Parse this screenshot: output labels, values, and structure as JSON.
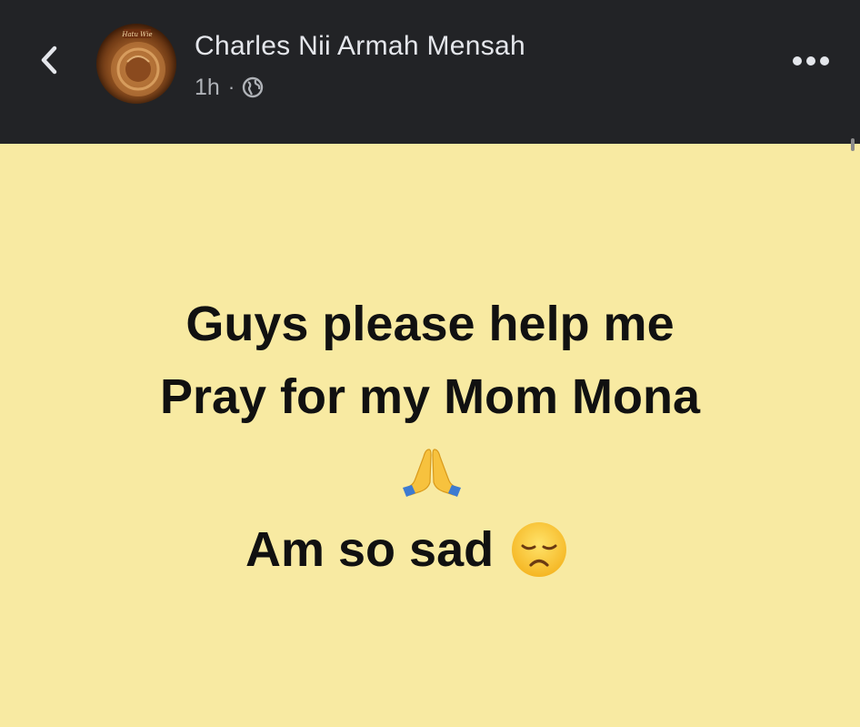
{
  "header": {
    "back_icon": "chevron-left-icon",
    "author_name": "Charles Nii Armah Mensah",
    "timestamp": "1h",
    "separator": "·",
    "privacy_icon": "globe-icon",
    "more_icon": "more-horizontal-icon",
    "avatar_badge_text": "Hatu Wie"
  },
  "post": {
    "background_color": "#f8eaa2",
    "line1": "Guys please help me",
    "line2": "Pray for my Mom Mona",
    "pray_emoji_icon": "folded-hands-emoji",
    "line3": "Am so sad",
    "sad_emoji_icon": "disappointed-face-emoji"
  },
  "colors": {
    "header_bg": "#222326",
    "name_text": "#e4e6eb",
    "meta_text": "#b0b3b8",
    "post_text": "#111111"
  }
}
